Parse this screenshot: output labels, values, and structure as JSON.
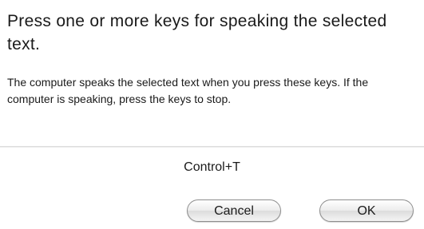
{
  "dialog": {
    "headline": "Press one or more keys for speaking the selected text.",
    "info": "The computer speaks the selected text when you press these keys.  If the computer is speaking, press the keys to stop.",
    "shortcut": "Control+T"
  },
  "buttons": {
    "cancel_label": "Cancel",
    "ok_label": "OK"
  }
}
